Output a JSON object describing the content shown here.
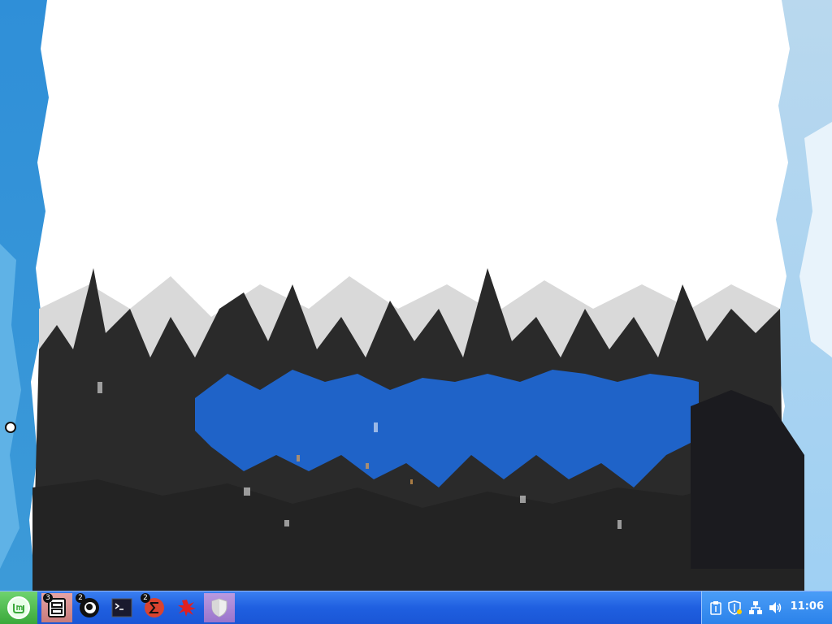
{
  "desktop": {
    "wallpaper": "abstract-painted-wallpaper",
    "colors": {
      "sky_white": "#ffffff",
      "side_blue": "#2f8fd8",
      "band_blue": "#1f63c8",
      "dark": "#262626"
    }
  },
  "taskbar": {
    "menu_icon": "linux-mint-logo-icon",
    "apps": [
      {
        "icon": "file-manager-icon",
        "badge": "3",
        "active": true
      },
      {
        "icon": "app-circle-icon",
        "badge": "2",
        "active": false
      },
      {
        "icon": "terminal-icon",
        "badge": "",
        "active": false
      },
      {
        "icon": "red-sigma-app-icon",
        "badge": "2",
        "active": false
      },
      {
        "icon": "red-splatter-app-icon",
        "badge": "",
        "active": false
      },
      {
        "icon": "shield-app-icon",
        "badge": "",
        "active": false
      }
    ]
  },
  "tray": {
    "icons": [
      "clipboard-icon",
      "update-shield-icon",
      "network-icon",
      "volume-icon"
    ],
    "clock": "11:06"
  }
}
